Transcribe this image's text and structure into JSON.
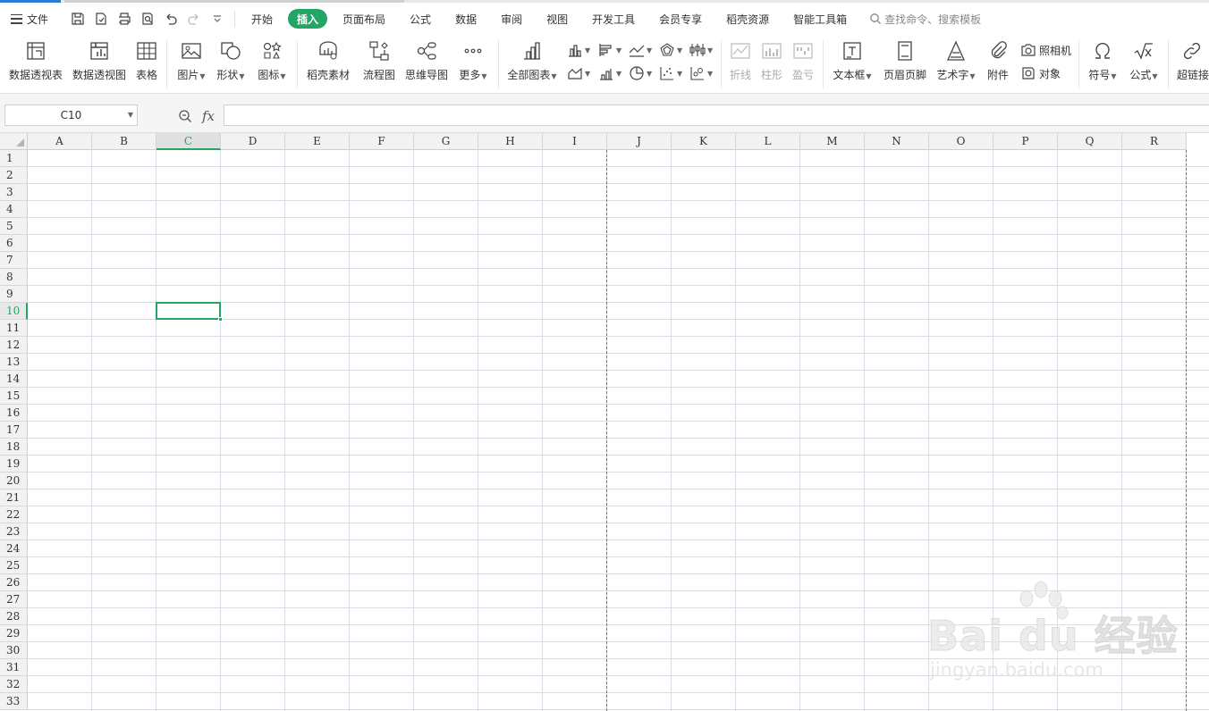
{
  "menu": {
    "file_label": "文件",
    "tabs": [
      {
        "label": "开始",
        "active": false
      },
      {
        "label": "插入",
        "active": true
      },
      {
        "label": "页面布局",
        "active": false
      },
      {
        "label": "公式",
        "active": false
      },
      {
        "label": "数据",
        "active": false
      },
      {
        "label": "审阅",
        "active": false
      },
      {
        "label": "视图",
        "active": false
      },
      {
        "label": "开发工具",
        "active": false
      },
      {
        "label": "会员专享",
        "active": false
      },
      {
        "label": "稻壳资源",
        "active": false
      },
      {
        "label": "智能工具箱",
        "active": false
      }
    ],
    "search_placeholder": "查找命令、搜索模板"
  },
  "ribbon": {
    "pivot_table": "数据透视表",
    "pivot_chart": "数据透视图",
    "table": "表格",
    "picture": "图片",
    "shape": "形状",
    "icon": "图标",
    "docer_material": "稻壳素材",
    "flowchart": "流程图",
    "mindmap": "思维导图",
    "more": "更多",
    "all_charts": "全部图表",
    "sparkline_line": "折线",
    "sparkline_column": "柱形",
    "sparkline_winloss": "盈亏",
    "textbox": "文本框",
    "header_footer": "页眉页脚",
    "wordart": "艺术字",
    "attachment": "附件",
    "camera": "照相机",
    "object": "对象",
    "symbol": "符号",
    "equation": "公式",
    "hyperlink": "超链接"
  },
  "formula_bar": {
    "name_box": "C10",
    "fx": "fx",
    "formula": ""
  },
  "sheet": {
    "columns": [
      "A",
      "B",
      "C",
      "D",
      "E",
      "F",
      "G",
      "H",
      "I",
      "J",
      "K",
      "L",
      "M",
      "N",
      "O",
      "P",
      "Q",
      "R"
    ],
    "rows": [
      "1",
      "2",
      "3",
      "4",
      "5",
      "6",
      "7",
      "8",
      "9",
      "10",
      "11",
      "12",
      "13",
      "14",
      "15",
      "16",
      "17",
      "18",
      "19",
      "20",
      "21",
      "22",
      "23",
      "24",
      "25",
      "26",
      "27",
      "28",
      "29",
      "30",
      "31",
      "32",
      "33"
    ],
    "selected_col": "C",
    "selected_row": "10"
  },
  "watermark": {
    "brand": "Bai du 经验",
    "url": "jingyan.baidu.com"
  },
  "colors": {
    "accent": "#23a566",
    "gridline": "#dadce6"
  }
}
